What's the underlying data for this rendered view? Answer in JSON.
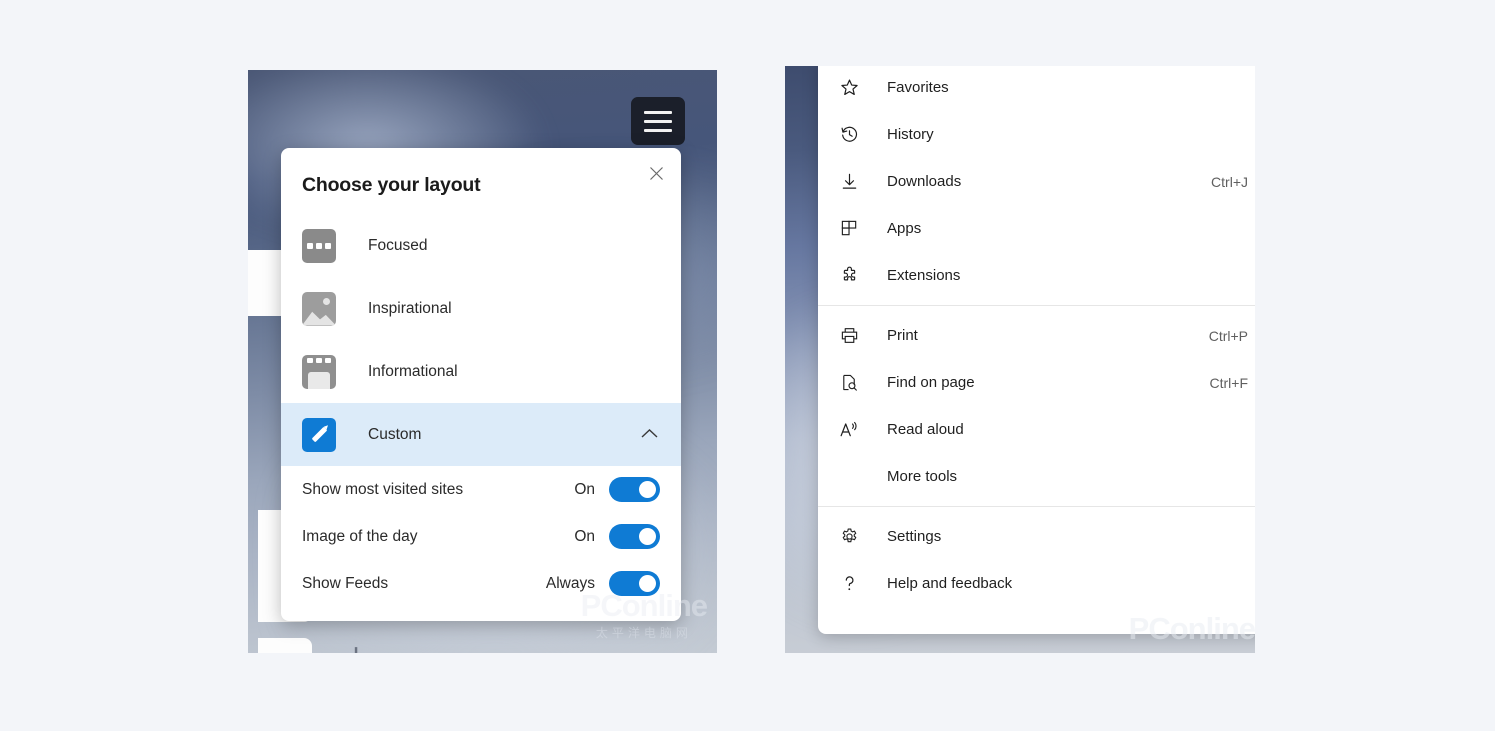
{
  "page": {
    "background_color": "#f3f5f9",
    "accent_color": "#0f7bd4",
    "highlight_color": "#dcebf9"
  },
  "left_panel": {
    "hamburger_icon": "hamburger-menu-icon",
    "dialog": {
      "title": "Choose your layout",
      "close_icon": "close-icon",
      "layout_options": [
        {
          "label": "Focused",
          "icon": "focused-layout-icon",
          "selected": false
        },
        {
          "label": "Inspirational",
          "icon": "inspirational-layout-icon",
          "selected": false
        },
        {
          "label": "Informational",
          "icon": "informational-layout-icon",
          "selected": false
        },
        {
          "label": "Custom",
          "icon": "custom-layout-pencil-icon",
          "selected": true,
          "chevron": "chevron-up-icon"
        }
      ],
      "settings": [
        {
          "label": "Show most visited sites",
          "value": "On",
          "toggle_on": true
        },
        {
          "label": "Image of the day",
          "value": "On",
          "toggle_on": true
        },
        {
          "label": "Show Feeds",
          "value": "Always",
          "toggle_on": true
        }
      ]
    },
    "background_tiles": {
      "add_tile_icon": "plus-icon"
    },
    "watermark": {
      "main": "PConline",
      "sub": "太平洋电脑网"
    }
  },
  "right_panel": {
    "menu": {
      "groups": [
        {
          "items": [
            {
              "label": "Favorites",
              "icon": "star-icon",
              "shortcut": "",
              "has_submenu": true
            },
            {
              "label": "History",
              "icon": "history-clock-icon",
              "shortcut": "",
              "has_submenu": true
            },
            {
              "label": "Downloads",
              "icon": "download-arrow-icon",
              "shortcut": "Ctrl+J",
              "has_submenu": false
            },
            {
              "label": "Apps",
              "icon": "apps-grid-icon",
              "shortcut": "",
              "has_submenu": true
            },
            {
              "label": "Extensions",
              "icon": "extensions-puzzle-icon",
              "shortcut": "",
              "has_submenu": false
            }
          ]
        },
        {
          "items": [
            {
              "label": "Print",
              "icon": "printer-icon",
              "shortcut": "Ctrl+P",
              "has_submenu": false
            },
            {
              "label": "Find on page",
              "icon": "find-on-page-icon",
              "shortcut": "Ctrl+F",
              "has_submenu": false
            },
            {
              "label": "Read aloud",
              "icon": "read-aloud-icon",
              "shortcut": "",
              "has_submenu": false
            },
            {
              "label": "More tools",
              "icon": "",
              "shortcut": "",
              "has_submenu": true
            }
          ]
        },
        {
          "items": [
            {
              "label": "Settings",
              "icon": "gear-icon",
              "shortcut": "",
              "has_submenu": false
            },
            {
              "label": "Help and feedback",
              "icon": "question-mark-icon",
              "shortcut": "",
              "has_submenu": true
            }
          ]
        }
      ]
    },
    "watermark": {
      "main": "PConline"
    }
  }
}
